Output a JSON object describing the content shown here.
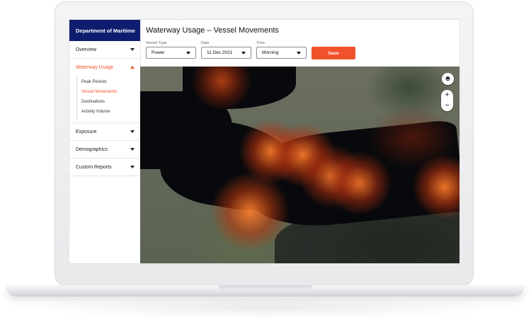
{
  "sidebar": {
    "brand": "Department of Maritime",
    "items": [
      {
        "label": "Overview"
      },
      {
        "label": "Waterway Usage"
      },
      {
        "label": "Exposure"
      },
      {
        "label": "Demographics"
      },
      {
        "label": "Custom Reports"
      }
    ],
    "subitems": [
      {
        "label": "Peak Periods"
      },
      {
        "label": "Vessel Movements"
      },
      {
        "label": "Destinations"
      },
      {
        "label": "Activity Volume"
      }
    ]
  },
  "header": {
    "title": "Waterway Usage – Vessel Movements"
  },
  "filters": {
    "vessel_type": {
      "label": "Vessel Type",
      "value": "Power"
    },
    "date": {
      "label": "Date",
      "value": "11 Dec 2021"
    },
    "time": {
      "label": "Time",
      "value": "Morning"
    },
    "save_label": "Save"
  },
  "map": {
    "layers_icon": "layers-icon",
    "zoom_in": "+",
    "zoom_out": "−"
  },
  "colors": {
    "brand": "#0f1d6e",
    "accent": "#f0522b"
  }
}
